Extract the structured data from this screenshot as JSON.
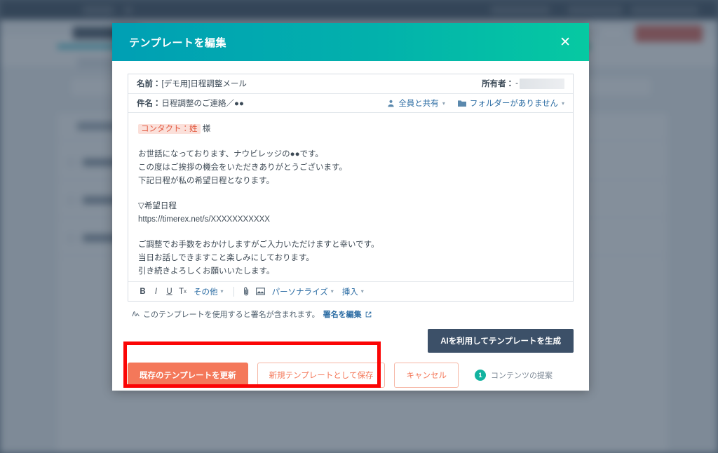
{
  "modal": {
    "title": "テンプレートを編集",
    "close_icon": "close-icon",
    "meta": {
      "name_label": "名前：",
      "name_value": "[デモ用]日程調整メール",
      "owner_label": "所有者：",
      "owner_value": "-",
      "subject_label": "件名：",
      "subject_value": "日程調整のご連絡／●●",
      "share_label": "全員と共有",
      "share_icon": "person-share-icon",
      "folder_label": "フォルダーがありません",
      "folder_icon": "folder-icon",
      "caret": "▾"
    },
    "body": {
      "token": "コンタクト：姓",
      "token_suffix": "様",
      "p1_line1": "お世話になっております、ナウビレッジの●●です。",
      "p1_line2": "この度はご挨拶の機会をいただきありがとうございます。",
      "p1_line3": "下記日程が私の希望日程となります。",
      "p2_line1": "▽希望日程",
      "p2_line2": "https://timerex.net/s/XXXXXXXXXXX",
      "p3_line1": "ご調整でお手数をおかけしますがご入力いただけますと幸いです。",
      "p3_line2": "当日お話しできますこと楽しみにしております。",
      "p3_line3": "引き続きよろしくお願いいたします。"
    },
    "toolbar": {
      "bold": "B",
      "italic": "I",
      "underline": "U",
      "clear_format": "T",
      "clear_format_sub": "x",
      "more_label": "その他",
      "attach_icon": "paperclip-icon",
      "image_icon": "image-icon",
      "personalize_label": "パーソナライズ",
      "insert_label": "挿入",
      "caret": "▾"
    },
    "signature": {
      "icon": "signature-icon",
      "note": "このテンプレートを使用すると署名が含まれます。",
      "link": "署名を編集",
      "external_icon": "external-link-icon"
    },
    "ai_button": "AIを利用してテンプレートを生成",
    "footer": {
      "update_button": "既存のテンプレートを更新",
      "save_as_new_button": "新規テンプレートとして保存",
      "cancel_button": "キャンセル",
      "suggestion_count": "1",
      "suggestion_label": "コンテンツの提案"
    }
  },
  "colors": {
    "header_gradient_start": "#009fb4",
    "header_gradient_end": "#06c9a2",
    "primary_orange": "#f4785a",
    "ai_button": "#3c5068",
    "badge_teal": "#12b3a0",
    "annotation_red": "#fb0505",
    "token_bg": "#fbe0da",
    "token_text": "#e2583f",
    "overlay": "#5d6d7d"
  }
}
